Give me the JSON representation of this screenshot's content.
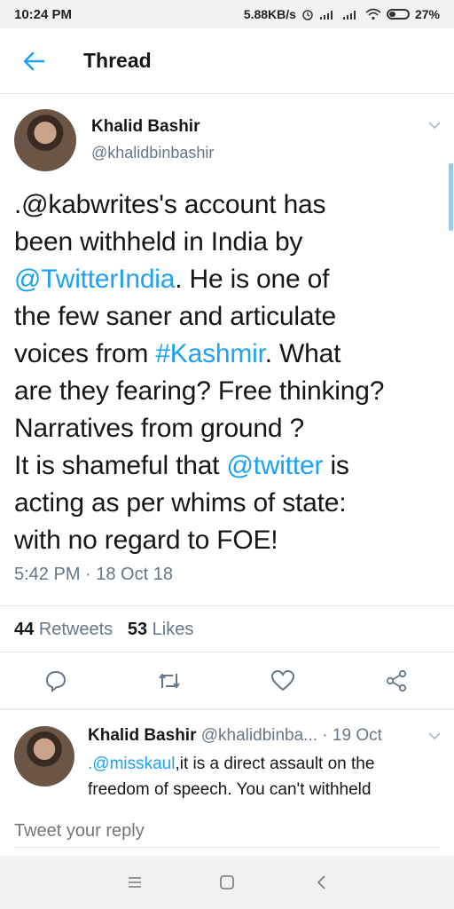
{
  "status_bar": {
    "time": "10:24 PM",
    "speed": "5.88KB/s",
    "battery": "27%",
    "icons": [
      "alarm-icon",
      "signal-icon",
      "signal-icon",
      "wifi-icon",
      "battery-icon"
    ]
  },
  "app_bar": {
    "title": "Thread",
    "back_icon": "arrow-left-icon"
  },
  "tweet": {
    "author_name": "Khalid Bashir",
    "author_handle": "@khalidbinbashir",
    "text_segments": [
      {
        "t": ".@kabwrites's account has\nbeen withheld in India by\n",
        "link": false
      },
      {
        "t": "@TwitterIndia",
        "link": true
      },
      {
        "t": ". He is one of\nthe few saner and articulate\nvoices from ",
        "link": false
      },
      {
        "t": "#Kashmir",
        "link": true
      },
      {
        "t": ". What\nare they fearing? Free thinking?\nNarratives from ground ?\nIt is shameful that ",
        "link": false
      },
      {
        "t": "@twitter",
        "link": true
      },
      {
        "t": " is\nacting as per whims of state:\nwith no regard to FOE!",
        "link": false
      }
    ],
    "timestamp": "5:42 PM · 18 Oct 18",
    "retweets_count": "44",
    "retweets_label": "Retweets",
    "likes_count": "53",
    "likes_label": "Likes",
    "actions": [
      "reply-icon",
      "retweet-icon",
      "like-icon",
      "share-icon"
    ]
  },
  "reply": {
    "author_name": "Khalid Bashir",
    "meta": "@khalidbinba... · 19 Oct",
    "text_link": ".@misskaul",
    "text_rest": ",it is a direct assault on the\nfreedom of speech. You can't withheld"
  },
  "reply_box": {
    "placeholder": "Tweet your reply"
  },
  "nav_bar": {
    "icons": [
      "menu-icon",
      "home-icon",
      "back-icon"
    ]
  },
  "colors": {
    "accent": "#1da1f2",
    "text": "#14171a",
    "muted": "#657786",
    "divider": "#e1e8ed"
  }
}
